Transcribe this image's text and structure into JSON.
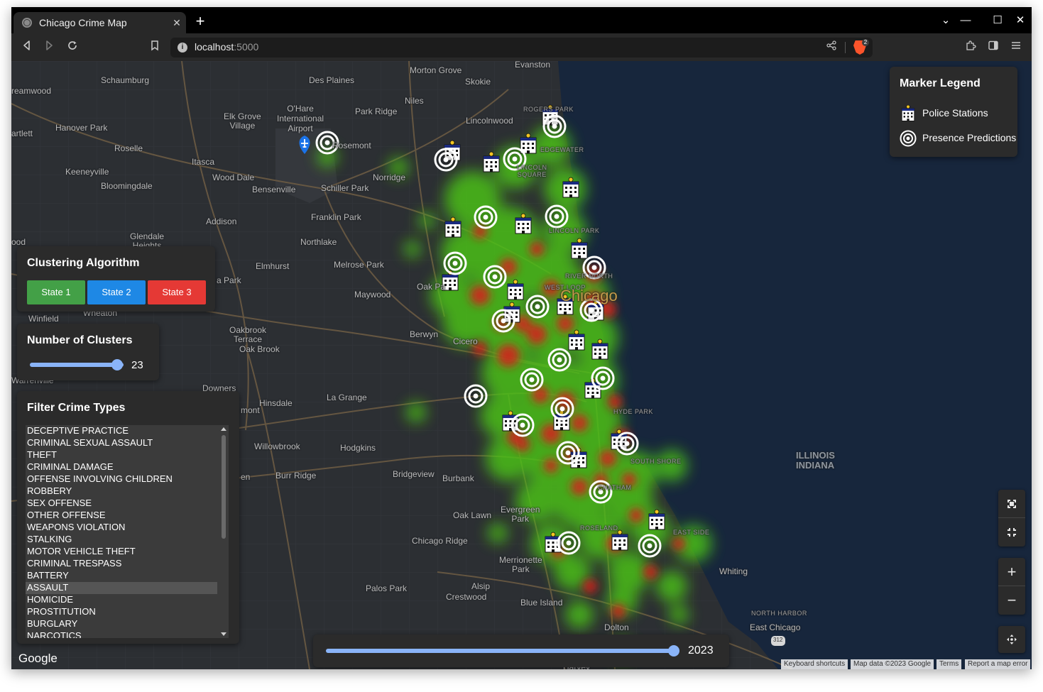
{
  "browser": {
    "tab_title": "Chicago Crime Map",
    "tab_close": "✕",
    "new_tab": "+",
    "url_host": "localhost",
    "url_port": ":5000",
    "brave_badge": "2"
  },
  "map": {
    "labels": {
      "evanston": "Evanston",
      "morton_grove": "Morton Grove",
      "des_plaines": "Des Plaines",
      "skokie": "Skokie",
      "schaumburg": "Schaumburg",
      "streamwood": "reamwood",
      "niles": "Niles",
      "ohare": "O'Hare\nInternational\nAirport",
      "elk_grove": "Elk Grove\nVillage",
      "park_ridge": "Park Ridge",
      "lincolnwood": "Lincolnwood",
      "rogers_park": "ROGERS PARK",
      "bartlett": "artlett",
      "hanover_park": "Hanover Park",
      "roselle": "Roselle",
      "rosemont": "Rosemont",
      "edgewater": "EDGEWATER",
      "itasca": "Itasca",
      "keeneyville": "Keeneyville",
      "wood_dale": "Wood Dale",
      "norridge": "Norridge",
      "lincoln_square": "LINCOLN\nSQUARE",
      "bloomingdale": "Bloomingdale",
      "bensenville": "Bensenville",
      "schiller_park": "Schiller Park",
      "franklin_park": "Franklin Park",
      "addison": "Addison",
      "lincoln_park": "LINCOLN PARK",
      "glendale_heights": "Glendale\nHeights",
      "northlake": "Northlake",
      "lombard": "ood",
      "elmhurst": "Elmhurst",
      "melrose_park": "Melrose Park",
      "river_north": "RIVER NORTH",
      "west_loop": "WEST LOOP",
      "villa_park": "a Park",
      "oak_park": "Oak Pa",
      "maywood": "Maywood",
      "chicago": "Chicago",
      "winfield": "Winfield",
      "wheaton": "Wheaton",
      "oakbrook_terrace": "Oakbrook\nTerrace",
      "oak_brook": "Oak Brook",
      "berwyn": "Berwyn",
      "cicero": "Cicero",
      "warrenville": "Warrenville",
      "downers_grove": "Downers",
      "hinsdale": "Hinsdale",
      "la_grange": "La Grange",
      "hyde_park": "HYDE PARK",
      "westmont": "mont",
      "willowbrook": "Willowbrook",
      "hodgkins": "Hodgkins",
      "illinois_indiana": "ILLINOIS\nINDIANA",
      "south_shore": "SOUTH SHORE",
      "burr_ridge": "Burr Ridge",
      "bridgeview": "Bridgeview",
      "burbank": "Burbank",
      "chatham": "CHATHAM",
      "darien": "en",
      "oak_lawn": "Oak Lawn",
      "evergreen_park": "Evergreen\nPark",
      "roseland": "ROSELAND",
      "east_side": "EAST SIDE",
      "chicago_ridge": "Chicago Ridge",
      "merrionette_park": "Merrionette\nPark",
      "whiting": "Whiting",
      "palos_park": "Palos Park",
      "alsip": "Alsip",
      "crestwood": "Crestwood",
      "blue_island": "Blue Island",
      "north_harbor": "NORTH HARBOR",
      "east_chicago": "East Chicago",
      "dolton": "Dolton",
      "harvey": "Harvey",
      "route_312": "312"
    },
    "attribution": {
      "shortcuts": "Keyboard shortcuts",
      "data": "Map data ©2023 Google",
      "terms": "Terms",
      "report": "Report a map error"
    },
    "google_logo": "Google",
    "controls": {
      "fullscreen": "fullscreen-icon",
      "exit_fullscreen": "exit-fullscreen-icon",
      "zoom_in": "+",
      "zoom_out": "−",
      "pan": "pan-icon"
    }
  },
  "legend": {
    "title": "Marker Legend",
    "items": [
      {
        "label": "Police Stations",
        "icon": "police-station-icon"
      },
      {
        "label": "Presence Predictions",
        "icon": "target-icon"
      }
    ]
  },
  "clustering": {
    "title": "Clustering Algorithm",
    "buttons": [
      {
        "label": "State 1",
        "color": "#43a047"
      },
      {
        "label": "State 2",
        "color": "#1e88e5"
      },
      {
        "label": "State 3",
        "color": "#e53935"
      }
    ]
  },
  "clusters": {
    "title": "Number of Clusters",
    "value": "23",
    "fraction": 0.93
  },
  "filter": {
    "title": "Filter Crime Types",
    "items": [
      "DECEPTIVE PRACTICE",
      "CRIMINAL SEXUAL ASSAULT",
      "THEFT",
      "CRIMINAL DAMAGE",
      "OFFENSE INVOLVING CHILDREN",
      "ROBBERY",
      "SEX OFFENSE",
      "OTHER OFFENSE",
      "WEAPONS VIOLATION",
      "STALKING",
      "MOTOR VEHICLE THEFT",
      "CRIMINAL TRESPASS",
      "BATTERY",
      "ASSAULT",
      "HOMICIDE",
      "PROSTITUTION",
      "BURGLARY",
      "NARCOTICS"
    ],
    "selected": "ASSAULT"
  },
  "year_slider": {
    "value": "2023",
    "fraction": 1.0
  },
  "colors": {
    "accent": "#8ab4f8",
    "panel_bg": "#2b2b2b",
    "water": "#17263c",
    "land": "#2c2f33",
    "heat_low": "#4cc417",
    "heat_high": "#d81c1c"
  }
}
